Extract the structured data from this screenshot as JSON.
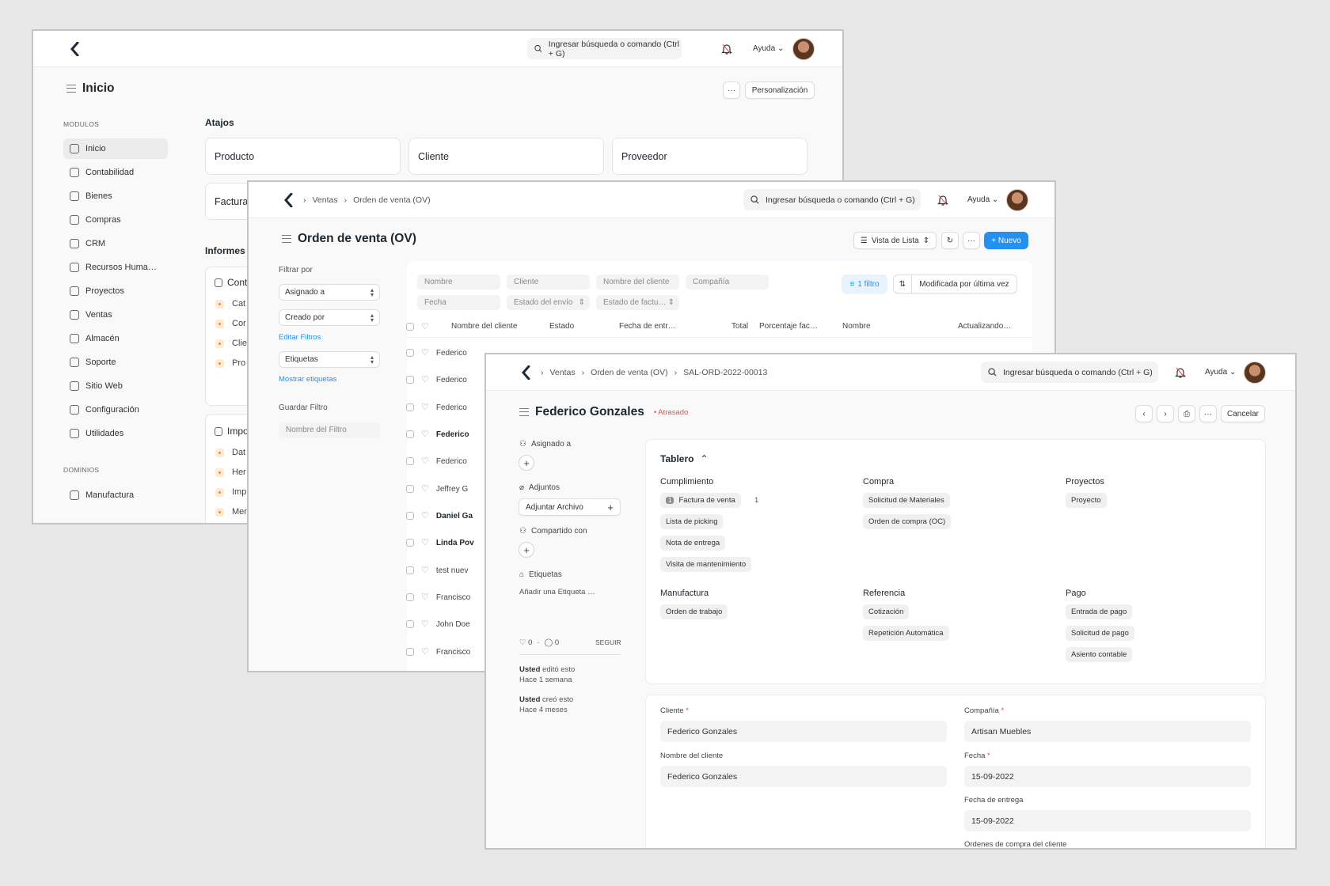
{
  "common": {
    "search_placeholder": "Ingresar búsqueda o comando (Ctrl + G)",
    "help_label": "Ayuda"
  },
  "home": {
    "title": "Inicio",
    "more_label": "···",
    "customize_label": "Personalización",
    "modules_heading": "MODULOS",
    "modules": [
      "Inicio",
      "Contabilidad",
      "Bienes",
      "Compras",
      "CRM",
      "Recursos Huma…",
      "Proyectos",
      "Ventas",
      "Almacén",
      "Soporte",
      "Sitio Web",
      "Configuración",
      "Utilidades"
    ],
    "domains_heading": "DOMINIOS",
    "domains": [
      "Manufactura"
    ],
    "shortcuts_heading": "Atajos",
    "shortcuts": [
      "Producto",
      "Cliente",
      "Proveedor",
      "Factura"
    ],
    "reports_heading": "Informes",
    "report_card1_title": "Cont",
    "report_card1_items": [
      "Cat",
      "Cor",
      "Clie",
      "Pro"
    ],
    "report_card2_title": "Impo",
    "report_card2_items": [
      "Dat",
      "Her",
      "Imp",
      "Mer"
    ]
  },
  "list": {
    "breadcrumb": [
      "Ventas",
      "Orden de venta (OV)"
    ],
    "title": "Orden de venta (OV)",
    "view_label": "Vista de Lista",
    "new_label": "+ Nuevo",
    "filter_by_label": "Filtrar por",
    "filter_selects": [
      "Asignado a",
      "Creado por"
    ],
    "edit_filters": "Editar Filtros",
    "tags_select": "Etiquetas",
    "show_tags": "Mostrar etiquetas",
    "save_filter_label": "Guardar Filtro",
    "filter_name_placeholder": "Nombre del Filtro",
    "filter_fields_row1": [
      "Nombre",
      "Cliente",
      "Nombre del cliente",
      "Compañía"
    ],
    "filter_fields_row2": [
      "Fecha",
      "Estado del envío",
      "Estado de factu…"
    ],
    "filter_count": "1 filtro",
    "sort_label": "Modificada por última vez",
    "columns": [
      "Nombre del cliente",
      "Estado",
      "Fecha de entr…",
      "Total",
      "Porcentaje fac…",
      "Nombre",
      "Actualizando…"
    ],
    "rows": [
      "Federico",
      "Federico",
      "Federico",
      "Federico",
      "Federico",
      "Jeffrey G",
      "Daniel Ga",
      "Linda Pov",
      "test nuev",
      "Francisco",
      "John Doe",
      "Francisco"
    ]
  },
  "form": {
    "breadcrumb": [
      "Ventas",
      "Orden de venta (OV)",
      "SAL-ORD-2022-00013"
    ],
    "title": "Federico Gonzales",
    "status": "Atrasado",
    "cancel_label": "Cancelar",
    "assigned_label": "Asignado a",
    "attachments_label": "Adjuntos",
    "attach_file_label": "Adjuntar Archivo",
    "shared_label": "Compartido con",
    "tags_label": "Etiquetas",
    "add_tag": "Añadir una Etiqueta …",
    "likes": "0",
    "comments": "0",
    "follow_label": "SEGUIR",
    "activity1_user": "Usted",
    "activity1_action": "editó esto",
    "activity1_time": "Hace 1 semana",
    "activity2_user": "Usted",
    "activity2_action": "creó esto",
    "activity2_time": "Hace 4 meses",
    "dashboard_title": "Tablero",
    "groups": [
      {
        "title": "Cumplimiento",
        "items": [
          "Factura de venta",
          "Lista de picking",
          "Nota de entrega",
          "Visita de mantenimiento"
        ],
        "first_count": "1",
        "first_badge": "1"
      },
      {
        "title": "Compra",
        "items": [
          "Solicitud de Materiales",
          "Orden de compra (OC)"
        ]
      },
      {
        "title": "Proyectos",
        "items": [
          "Proyecto"
        ]
      },
      {
        "title": "Manufactura",
        "items": [
          "Orden de trabajo"
        ]
      },
      {
        "title": "Referencia",
        "items": [
          "Cotización",
          "Repetición Automática"
        ]
      },
      {
        "title": "Pago",
        "items": [
          "Entrada de pago",
          "Solicitud de pago",
          "Asiento contable"
        ]
      }
    ],
    "fields": {
      "customer_label": "Cliente",
      "customer_value": "Federico Gonzales",
      "customer_name_label": "Nombre del cliente",
      "customer_name_value": "Federico Gonzales",
      "company_label": "Compañía",
      "company_value": "Artisan Muebles",
      "date_label": "Fecha",
      "date_value": "15-09-2022",
      "delivery_label": "Fecha de entrega",
      "delivery_value": "15-09-2022",
      "po_label": "Ordenes de compra del cliente"
    },
    "required_mark": "*"
  }
}
